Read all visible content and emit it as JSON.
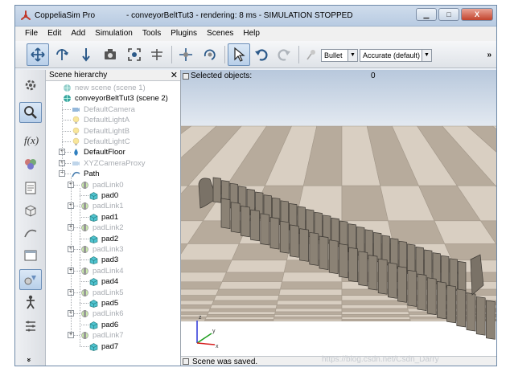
{
  "window": {
    "app_name": "CoppeliaSim Pro",
    "doc_title": "- conveyorBeltTut3 - rendering: 8 ms - SIMULATION STOPPED",
    "minimize": "▁",
    "maximize": "□",
    "close": "X"
  },
  "menu": [
    "File",
    "Edit",
    "Add",
    "Simulation",
    "Tools",
    "Plugins",
    "Scenes",
    "Help"
  ],
  "toolbar": {
    "engine": "Bullet",
    "accuracy": "Accurate (default)",
    "more": "»"
  },
  "left_toolbar": {
    "more": "»"
  },
  "hierarchy": {
    "title": "Scene hierarchy",
    "close": "✕",
    "items": [
      {
        "label": "new scene (scene 1)",
        "grey": true
      },
      {
        "label": "conveyorBeltTut3 (scene 2)",
        "grey": false
      },
      {
        "label": "DefaultCamera",
        "grey": true
      },
      {
        "label": "DefaultLightA",
        "grey": true
      },
      {
        "label": "DefaultLightB",
        "grey": true
      },
      {
        "label": "DefaultLightC",
        "grey": true
      },
      {
        "label": "DefaultFloor",
        "grey": false
      },
      {
        "label": "XYZCameraProxy",
        "grey": true
      },
      {
        "label": "Path",
        "grey": false
      },
      {
        "label": "padLink0",
        "grey": true
      },
      {
        "label": "pad0",
        "grey": false
      },
      {
        "label": "padLink1",
        "grey": true
      },
      {
        "label": "pad1",
        "grey": false
      },
      {
        "label": "padLink2",
        "grey": true
      },
      {
        "label": "pad2",
        "grey": false
      },
      {
        "label": "padLink3",
        "grey": true
      },
      {
        "label": "pad3",
        "grey": false
      },
      {
        "label": "padLink4",
        "grey": true
      },
      {
        "label": "pad4",
        "grey": false
      },
      {
        "label": "padLink5",
        "grey": true
      },
      {
        "label": "pad5",
        "grey": false
      },
      {
        "label": "padLink6",
        "grey": true
      },
      {
        "label": "pad6",
        "grey": false
      },
      {
        "label": "padLink7",
        "grey": true
      },
      {
        "label": "pad7",
        "grey": false
      }
    ]
  },
  "viewport": {
    "selected_label": "Selected objects:",
    "selected_count": "0",
    "axis_z": "z",
    "axis_y": "y",
    "axis_x": "x"
  },
  "status": {
    "message": "Scene was saved."
  },
  "watermark": "https://blog.csdn.net/Csdn_Darry",
  "colors": {
    "floor_light": "#d9cfc2",
    "floor_dark": "#b7ab9c",
    "pad": "#8b8275",
    "accent": "#b8cfe9"
  }
}
